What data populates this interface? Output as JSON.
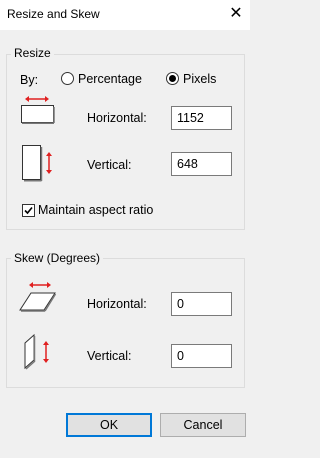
{
  "window": {
    "title": "Resize and Skew",
    "close_glyph": "✕"
  },
  "resize": {
    "legend": "Resize",
    "by_label": "By:",
    "options": [
      {
        "label": "Percentage",
        "selected": false
      },
      {
        "label": "Pixels",
        "selected": true
      }
    ],
    "horizontal": {
      "label": "Horizontal:",
      "value": "1152"
    },
    "vertical": {
      "label": "Vertical:",
      "value": "648"
    },
    "maintain_aspect": {
      "label": "Maintain aspect ratio",
      "checked": true
    }
  },
  "skew": {
    "legend": "Skew (Degrees)",
    "horizontal": {
      "label": "Horizontal:",
      "value": "0"
    },
    "vertical": {
      "label": "Vertical:",
      "value": "0"
    }
  },
  "buttons": {
    "ok": "OK",
    "cancel": "Cancel"
  },
  "colors": {
    "accent": "#0078d7",
    "arrow": "#e02020"
  }
}
